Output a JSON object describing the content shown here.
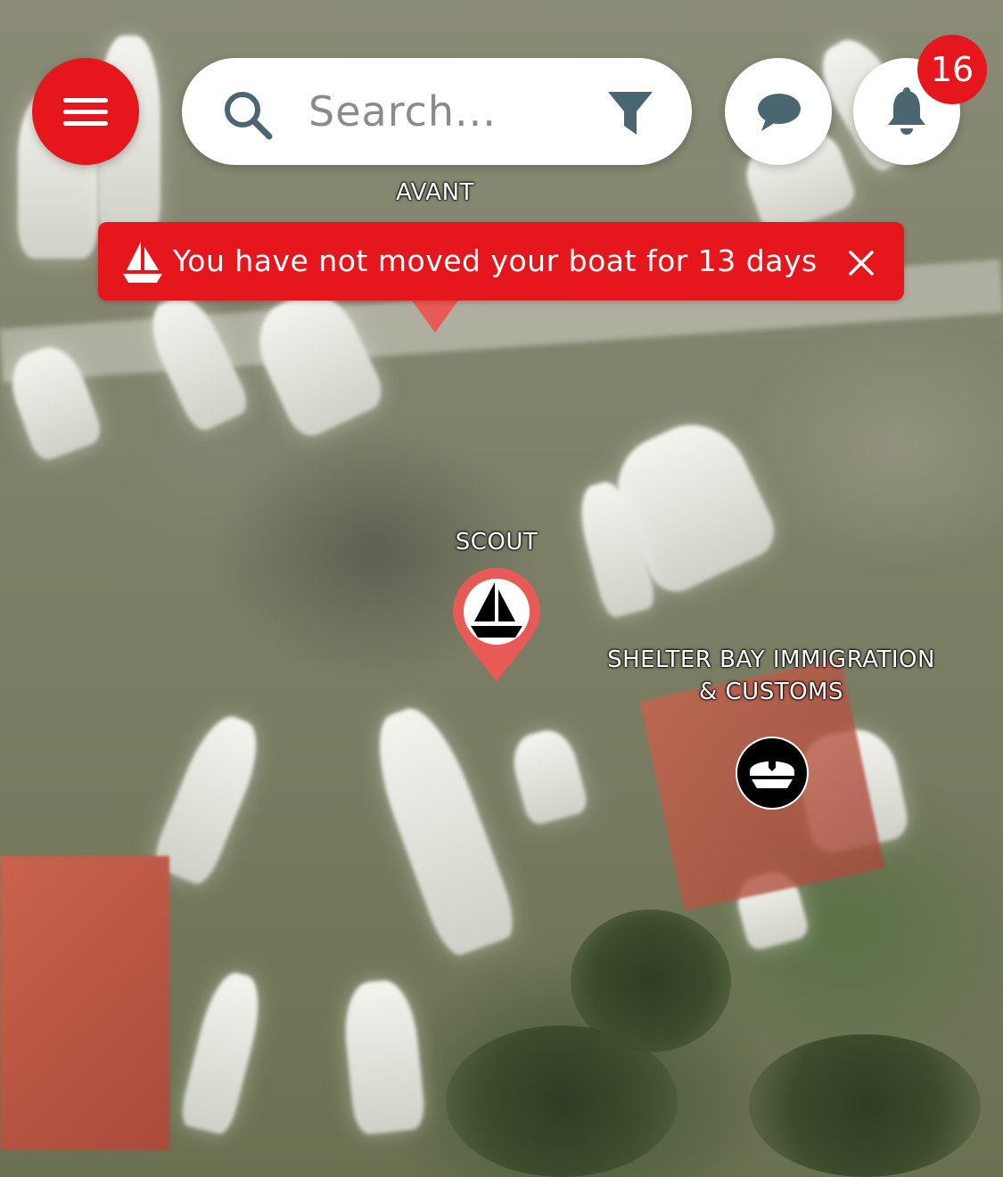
{
  "header": {
    "menu_icon": "hamburger-menu-icon",
    "search": {
      "placeholder": "Search...",
      "value": "",
      "search_icon": "search-icon",
      "filter_icon": "filter-icon"
    },
    "chat_icon": "chat-bubble-icon",
    "notifications": {
      "icon": "bell-icon",
      "count": "16"
    }
  },
  "alert": {
    "icon": "sailboat-icon",
    "message": "You have not moved your boat for 13 days",
    "close_icon": "close-icon"
  },
  "map": {
    "markers": [
      {
        "label": "AVANT",
        "type": "boat"
      },
      {
        "label": "SCOUT",
        "type": "boat"
      },
      {
        "label_line1": "SHELTER BAY IMMIGRATION",
        "label_line2": "& CUSTOMS",
        "type": "customs"
      }
    ]
  },
  "colors": {
    "accent": "#e5161c",
    "pin": "#e85a55",
    "icon_dark": "#4a6670"
  }
}
